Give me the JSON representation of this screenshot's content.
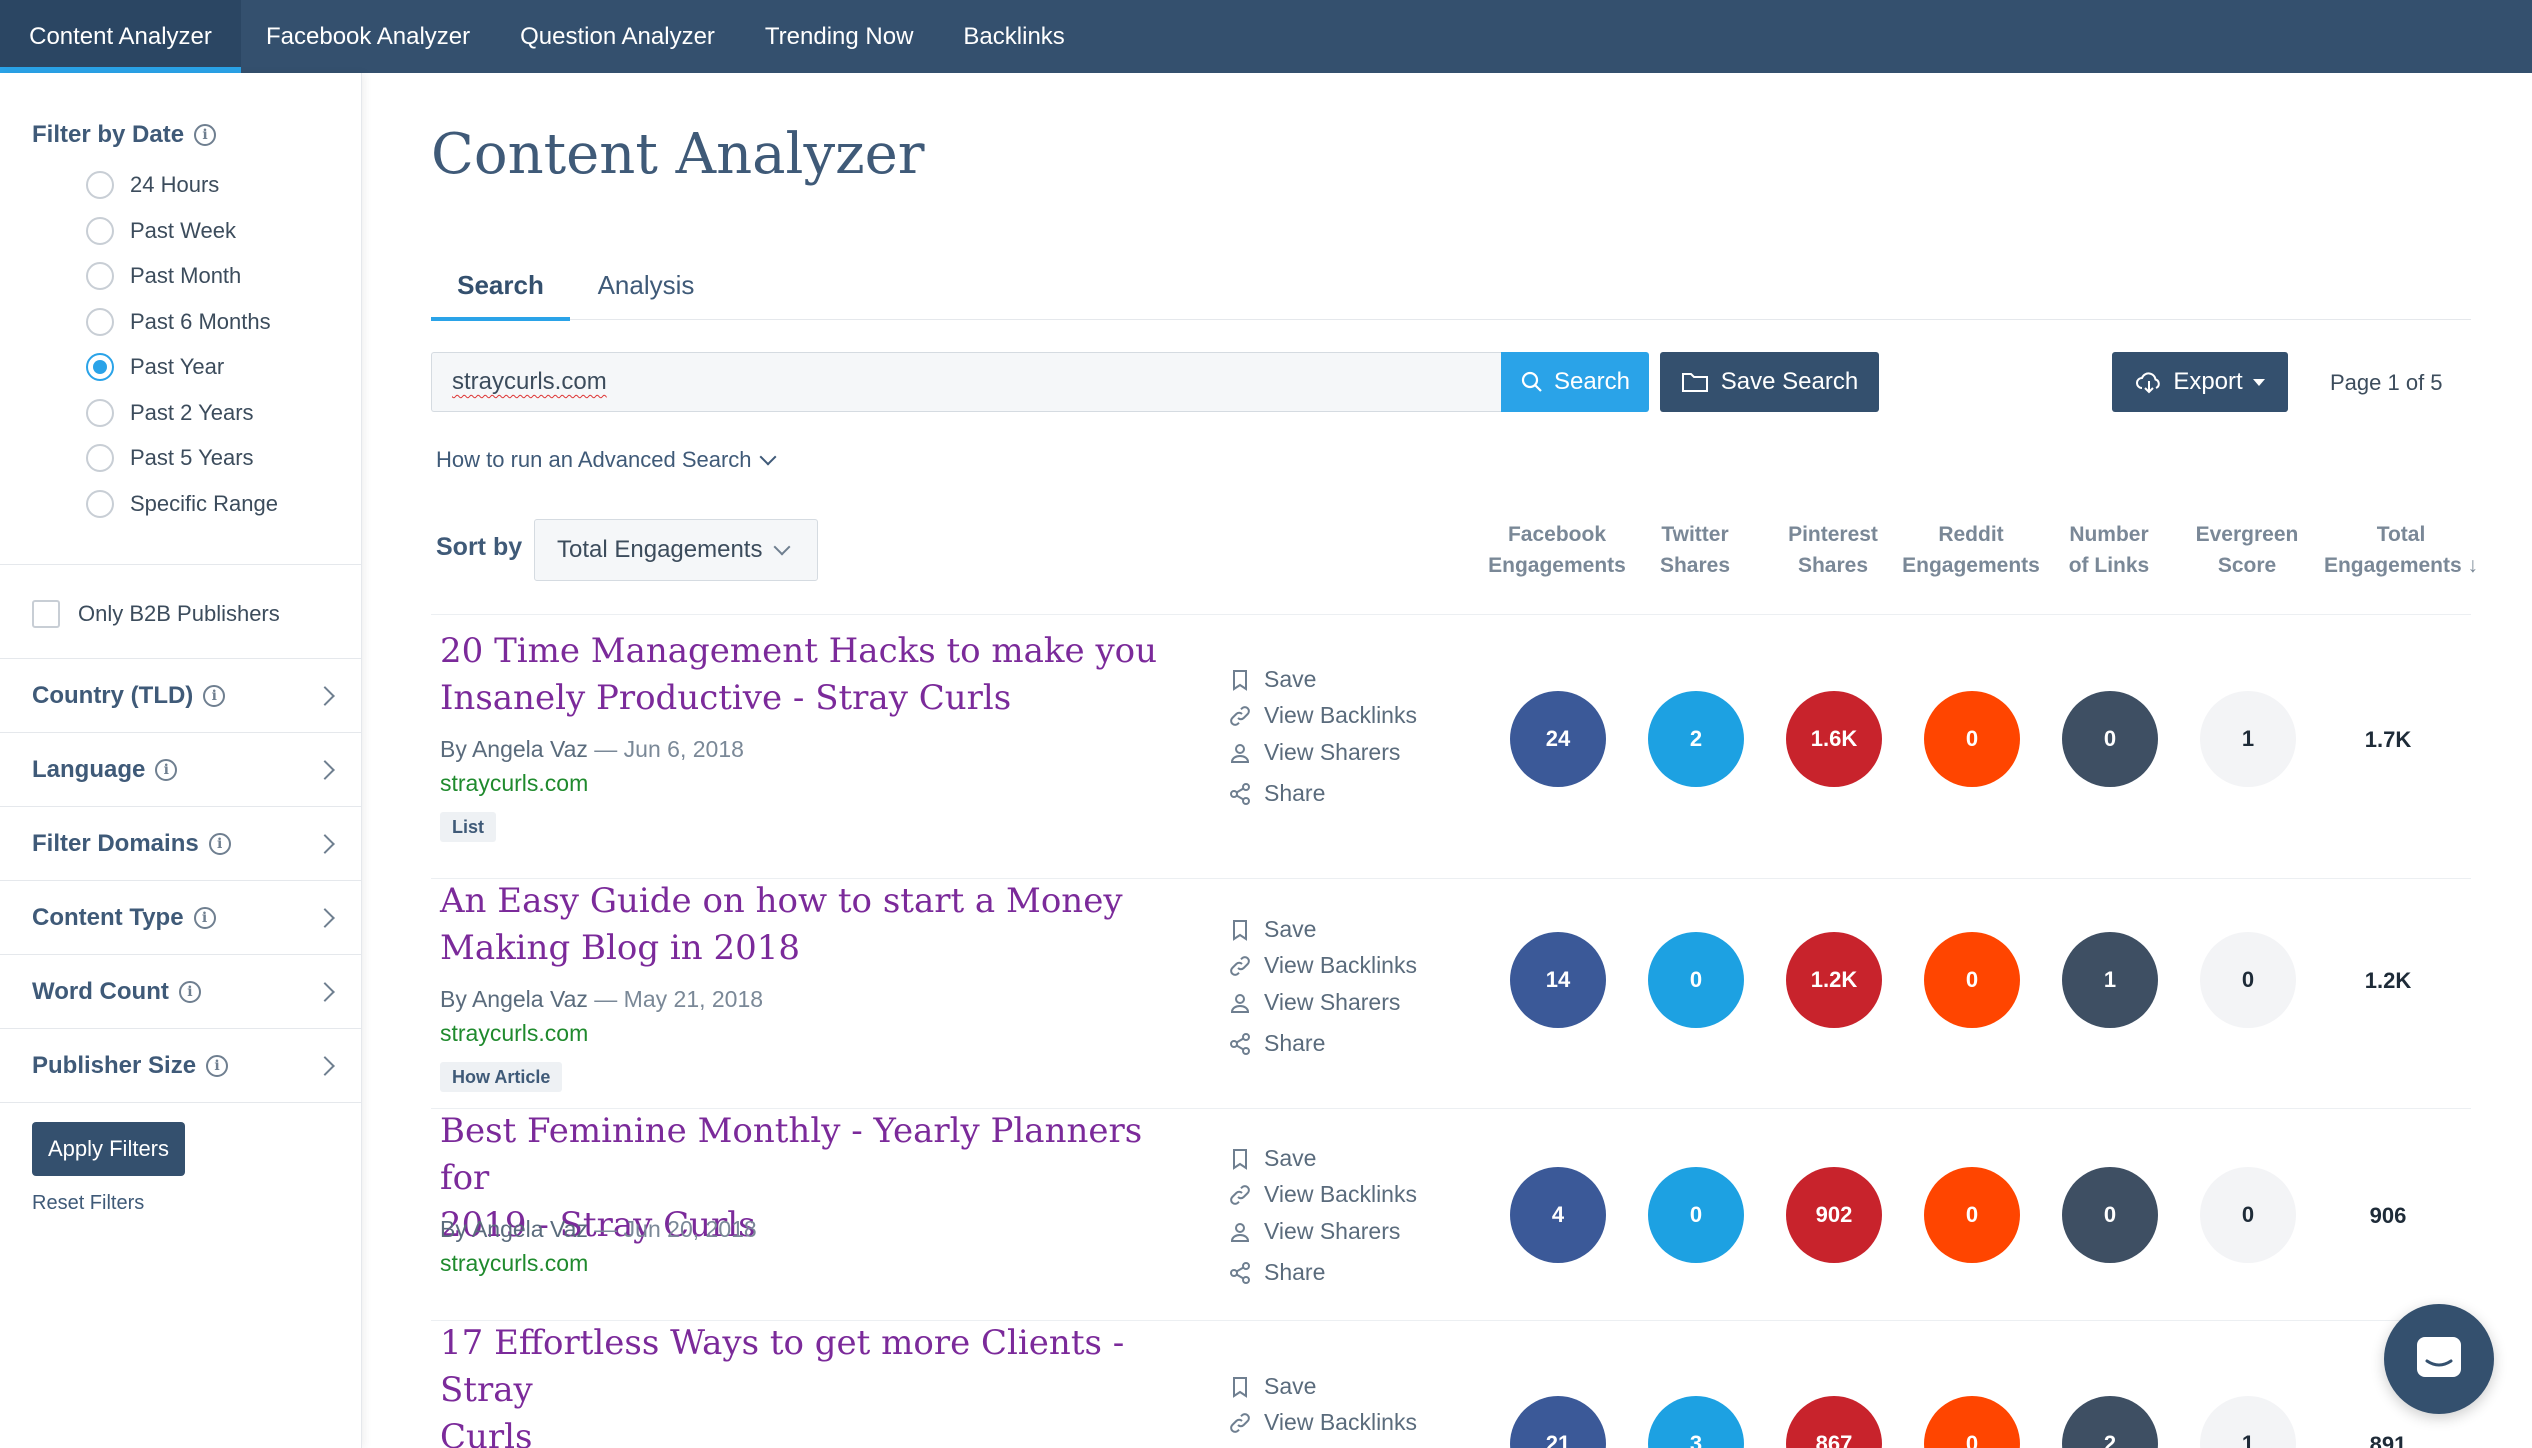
{
  "nav": {
    "items": [
      "Content Analyzer",
      "Facebook Analyzer",
      "Question Analyzer",
      "Trending Now",
      "Backlinks"
    ],
    "active": 0
  },
  "sidebar": {
    "filter_by_date": "Filter by Date",
    "date_options": [
      "24 Hours",
      "Past Week",
      "Past Month",
      "Past 6 Months",
      "Past Year",
      "Past 2 Years",
      "Past 5 Years",
      "Specific Range"
    ],
    "selected_date": "Past Year",
    "b2b_label": "Only B2B Publishers",
    "filters": [
      "Country (TLD)",
      "Language",
      "Filter Domains",
      "Content Type",
      "Word Count",
      "Publisher Size"
    ],
    "apply_label": "Apply Filters",
    "reset_label": "Reset Filters"
  },
  "main": {
    "title": "Content Analyzer",
    "tabs": [
      "Search",
      "Analysis"
    ],
    "search_value": "straycurls.com",
    "search_button": "Search",
    "save_search_button": "Save Search",
    "export_button": "Export",
    "page_info": "Page 1 of 5",
    "advanced_search": "How to run an Advanced Search",
    "sort_label": "Sort by",
    "sort_value": "Total Engagements"
  },
  "columns": [
    {
      "l1": "Facebook",
      "l2": "Engagements"
    },
    {
      "l1": "Twitter",
      "l2": "Shares"
    },
    {
      "l1": "Pinterest",
      "l2": "Shares"
    },
    {
      "l1": "Reddit",
      "l2": "Engagements"
    },
    {
      "l1": "Number",
      "l2": "of Links"
    },
    {
      "l1": "Evergreen",
      "l2": "Score"
    },
    {
      "l1": "Total",
      "l2": "Engagements ↓"
    }
  ],
  "actions": [
    "Save",
    "View Backlinks",
    "View Sharers",
    "Share"
  ],
  "colors": {
    "facebook": "#3b5998",
    "twitter": "#1da1e2",
    "pinterest": "#c8232c",
    "reddit": "#ff4500",
    "links": "#3e4f63",
    "evergreen": "#f3f4f6",
    "accent": "#2aa3e8",
    "nav": "#34506e"
  },
  "articles": [
    {
      "title_l1": "20 Time Management Hacks to make you",
      "title_l2": "Insanely Productive - Stray Curls",
      "author": "By Angela Vaz",
      "date": "— Jun 6, 2018",
      "domain": "straycurls.com",
      "tag": "List",
      "facebook": "24",
      "twitter": "2",
      "pinterest": "1.6K",
      "reddit": "0",
      "links": "0",
      "evergreen": "1",
      "total": "1.7K"
    },
    {
      "title_l1": "An Easy Guide on how to start a Money",
      "title_l2": "Making Blog in 2018",
      "author": "By Angela Vaz",
      "date": "— May 21, 2018",
      "domain": "straycurls.com",
      "tag": "How Article",
      "facebook": "14",
      "twitter": "0",
      "pinterest": "1.2K",
      "reddit": "0",
      "links": "1",
      "evergreen": "0",
      "total": "1.2K"
    },
    {
      "title_l1": "Best Feminine Monthly - Yearly Planners for",
      "title_l2": "2019 - Stray Curls",
      "author": "By Angela Vaz",
      "date": "— Jun 20, 2018",
      "domain": "straycurls.com",
      "tag": "",
      "facebook": "4",
      "twitter": "0",
      "pinterest": "902",
      "reddit": "0",
      "links": "0",
      "evergreen": "0",
      "total": "906"
    },
    {
      "title_l1": "17 Effortless Ways to get more Clients - Stray",
      "title_l2": "Curls",
      "author": "",
      "date": "",
      "domain": "",
      "tag": "",
      "facebook": "21",
      "twitter": "3",
      "pinterest": "867",
      "reddit": "0",
      "links": "2",
      "evergreen": "1",
      "total": "891"
    }
  ]
}
